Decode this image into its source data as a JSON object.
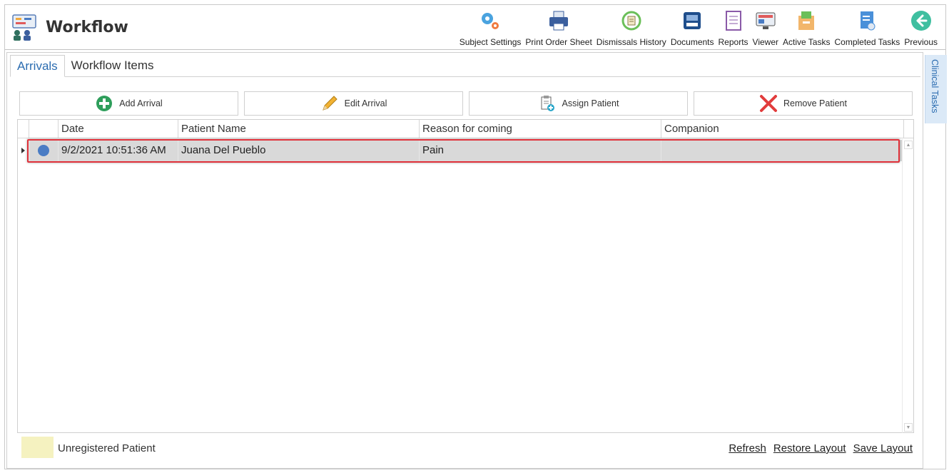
{
  "app": {
    "title": "Workflow"
  },
  "toolbar": [
    {
      "label": "Subject Settings",
      "icon": "gears-icon"
    },
    {
      "label": "Print Order Sheet",
      "icon": "printer-icon"
    },
    {
      "label": "Dismissals History",
      "icon": "history-icon"
    },
    {
      "label": "Documents",
      "icon": "document-tray-icon"
    },
    {
      "label": "Reports",
      "icon": "report-icon"
    },
    {
      "label": "Viewer",
      "icon": "viewer-icon"
    },
    {
      "label": "Active Tasks",
      "icon": "active-tasks-icon"
    },
    {
      "label": "Completed Tasks",
      "icon": "completed-tasks-icon"
    },
    {
      "label": "Previous",
      "icon": "arrow-left-icon"
    }
  ],
  "tabs": [
    {
      "label": "Arrivals",
      "active": true
    },
    {
      "label": "Workflow Items",
      "active": false
    }
  ],
  "actions": [
    {
      "label": "Add Arrival",
      "icon": "plus-circle-icon"
    },
    {
      "label": "Edit Arrival",
      "icon": "pencil-icon"
    },
    {
      "label": "Assign Patient",
      "icon": "clipboard-add-icon"
    },
    {
      "label": "Remove Patient",
      "icon": "x-icon"
    }
  ],
  "grid": {
    "columns": [
      "Date",
      "Patient Name",
      "Reason for coming",
      "Companion"
    ],
    "rows": [
      {
        "date": "9/2/2021 10:51:36 AM",
        "patient_name": "Juana Del Pueblo",
        "reason": "Pain",
        "companion": "",
        "status_color": "#4a7cc4",
        "selected": true
      }
    ]
  },
  "legend": {
    "label": "Unregistered Patient",
    "color": "#f5f2c0"
  },
  "footer_links": [
    "Refresh",
    "Restore Layout",
    "Save Layout"
  ],
  "side_tab": {
    "label": "Clinical Tasks"
  },
  "colors": {
    "accent": "#2b6cb0",
    "highlight": "#e0313a",
    "selected_row": "#d9d9d9"
  }
}
